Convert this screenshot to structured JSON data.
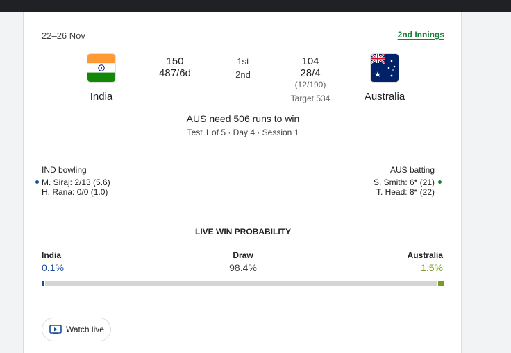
{
  "match": {
    "dates": "22–26 Nov",
    "innings_link": "2nd Innings",
    "status": "AUS need 506 runs to win",
    "sub_status": "Test 1 of 5 · Day 4 · Session 1"
  },
  "teams": {
    "home": {
      "name": "India",
      "flag_icon": "india-flag-icon"
    },
    "away": {
      "name": "Australia",
      "flag_icon": "australia-flag-icon"
    }
  },
  "scores": {
    "home_1st": "150",
    "home_2nd": "487/6d",
    "innings_1": "1st",
    "innings_2": "2nd",
    "away_1st": "104",
    "away_2nd": "28/4",
    "away_overs": "(12/190)",
    "target": "Target 534"
  },
  "bowling": {
    "heading": "IND bowling",
    "players": [
      "M. Siraj: 2/13 (5.6)",
      "H. Rana: 0/0 (1.0)"
    ]
  },
  "batting": {
    "heading": "AUS batting",
    "players": [
      "S. Smith: 6* (21)",
      "T. Head: 8* (22)"
    ]
  },
  "win_probability": {
    "title": "LIVE WIN PROBABILITY",
    "teams": [
      {
        "name": "India",
        "value_label": "0.1%",
        "value": 0.1,
        "color": "#1a4b9a"
      },
      {
        "name": "Draw",
        "value_label": "98.4%",
        "value": 98.4,
        "color": "#d5d5d5"
      },
      {
        "name": "Australia",
        "value_label": "1.5%",
        "value": 1.5,
        "color": "#7a9a2a"
      }
    ]
  },
  "watch_live": {
    "label": "Watch live",
    "icon": "play-screen-icon"
  },
  "colors": {
    "innings_link": "#188038",
    "live_dot_bowling": "#1a4b9a",
    "live_dot_batting": "#188038"
  }
}
